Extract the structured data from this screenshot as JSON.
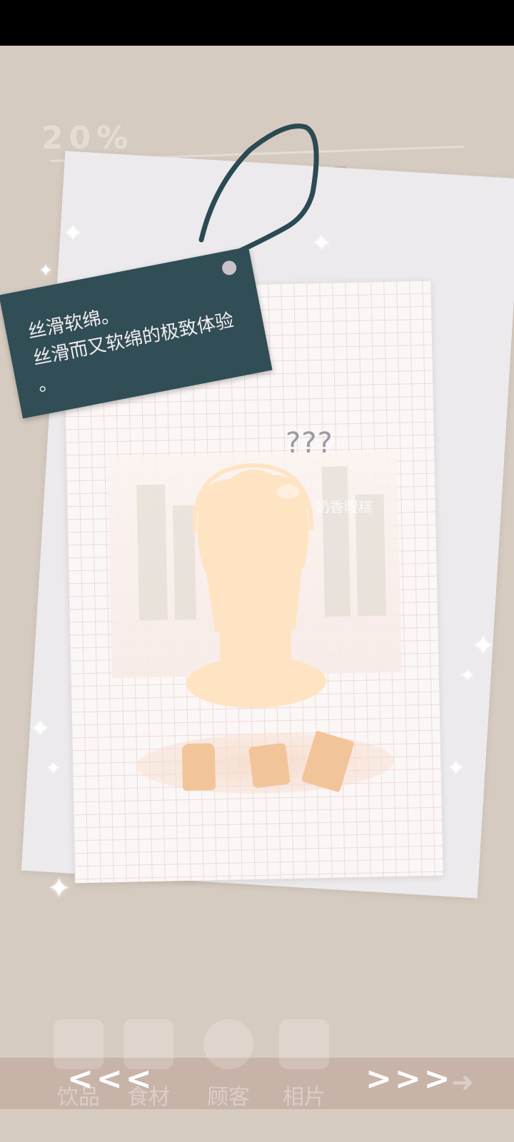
{
  "background": {
    "percent_text": "20%",
    "ghost_label": "饮品"
  },
  "tag": {
    "line1": "丝滑软绵。",
    "line2": "丝滑而又软绵的极致体验",
    "line3": "。"
  },
  "card": {
    "unknown_marks": "???",
    "faded_name": "奶香暖糕"
  },
  "bottom_nav": {
    "items": [
      {
        "label": "饮品",
        "icon": "drink-icon"
      },
      {
        "label": "食材",
        "icon": "ingredients-icon"
      },
      {
        "label": "顾客",
        "icon": "customer-icon"
      },
      {
        "label": "相片",
        "icon": "photo-icon"
      }
    ]
  },
  "nav_arrows": {
    "prev": "<<<",
    "next": ">>>"
  },
  "colors": {
    "tag": "#314d56",
    "background": "#d7ccc1",
    "silhouette": "#ffe4c4"
  }
}
